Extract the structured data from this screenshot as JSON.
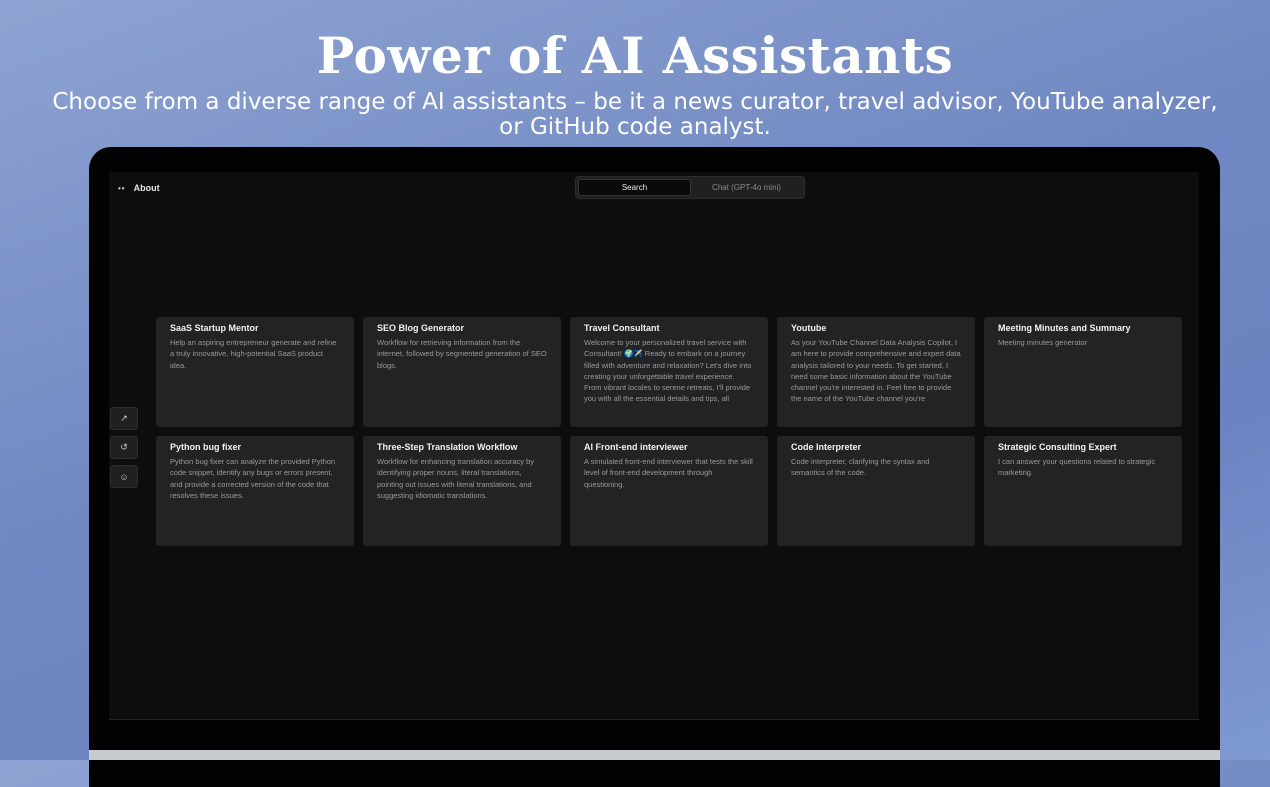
{
  "headline": "Power of AI Assistants",
  "subline": "Choose from a diverse range of AI assistants – be it a news curator, travel advisor, YouTube analyzer, or GitHub code analyst.",
  "app": {
    "about_label": "About",
    "about_icon": "dots-icon",
    "tabs": [
      {
        "label": "Search",
        "active": true
      },
      {
        "label": "Chat (GPT-4o mini)",
        "active": false
      }
    ],
    "side_buttons": [
      {
        "icon": "trending-icon",
        "glyph": "↗"
      },
      {
        "icon": "history-icon",
        "glyph": "↺"
      },
      {
        "icon": "chat-icon",
        "glyph": "☺"
      }
    ],
    "cards": [
      {
        "title": "SaaS Startup Mentor",
        "desc": "Help an aspiring entrepreneur generate and refine a truly innovative, high-potential SaaS product idea."
      },
      {
        "title": "SEO Blog Generator",
        "desc": "Workflow for retrieving information from the internet, followed by segmented generation of SEO blogs."
      },
      {
        "title": "Travel Consultant",
        "desc": "Welcome to your personalized travel service with Consultant! 🌍✈️ Ready to embark on a journey filled with adventure and relaxation? Let's dive into creating your unforgettable travel experience. From vibrant locales to serene retreats, I'll provide you with all the essential details and tips, all"
      },
      {
        "title": "Youtube",
        "desc": "As your YouTube Channel Data Analysis Copilot, I am here to provide comprehensive and expert data analysis tailored to your needs. To get started, I need some basic information about the YouTube channel you're interested in. Feel free to provide the name of the YouTube channel you're"
      },
      {
        "title": "Meeting Minutes and Summary",
        "desc": "Meeting minutes generator"
      },
      {
        "title": "Python bug fixer",
        "desc": "Python bug fixer can analyze the provided Python code snippet, identify any bugs or errors present, and provide a corrected version of the code that resolves these issues."
      },
      {
        "title": "Three-Step Translation Workflow",
        "desc": "Workflow for enhancing translation accuracy by identifying proper nouns, literal translations, pointing out issues with literal translations, and suggesting idiomatic translations."
      },
      {
        "title": "AI Front-end interviewer",
        "desc": "A simulated front-end interviewer that tests the skill level of front-end development through questioning."
      },
      {
        "title": "Code Interpreter",
        "desc": "Code interpreter, clarifying the syntax and semantics of the code."
      },
      {
        "title": "Strategic Consulting Expert",
        "desc": "I can answer your questions related to strategic marketing."
      }
    ]
  }
}
